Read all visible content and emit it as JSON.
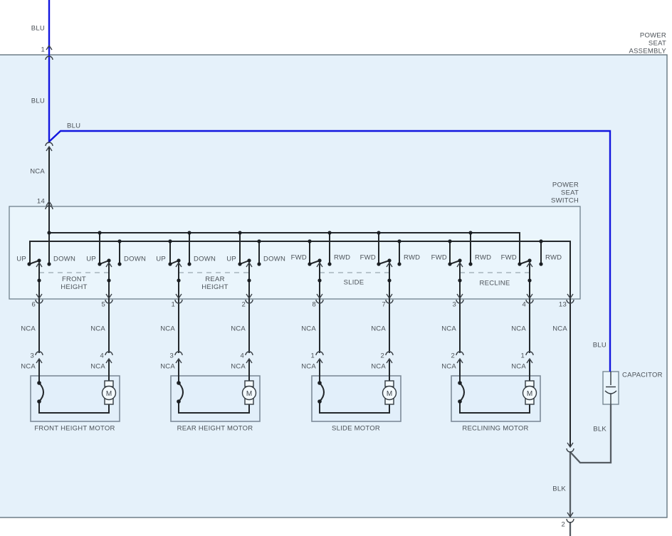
{
  "assembly_title": "POWER\nSEAT\nASSEMBLY",
  "switch_title": "POWER\nSEAT\nSWITCH",
  "labels": {
    "blu": "BLU",
    "nca": "NCA",
    "blk": "BLK",
    "up": "UP",
    "down": "DOWN",
    "fwd": "FWD",
    "rwd": "RWD",
    "capacitor": "CAPACITOR",
    "motor_m": "M"
  },
  "pins": {
    "top": "1",
    "switch_in": "14",
    "bottom": "2"
  },
  "switch_pins": [
    "6",
    "5",
    "1",
    "2",
    "8",
    "7",
    "3",
    "4",
    "13"
  ],
  "connector_pins": [
    "3",
    "4",
    "3",
    "4",
    "1",
    "2",
    "2",
    "1"
  ],
  "groups": [
    {
      "name": "FRONT\nHEIGHT"
    },
    {
      "name": "REAR\nHEIGHT"
    },
    {
      "name": "SLIDE"
    },
    {
      "name": "RECLINE"
    }
  ],
  "motors": [
    {
      "name": "FRONT HEIGHT MOTOR"
    },
    {
      "name": "REAR HEIGHT MOTOR"
    },
    {
      "name": "SLIDE MOTOR"
    },
    {
      "name": "RECLINING MOTOR"
    }
  ],
  "colors": {
    "wire_blue": "#1216df",
    "wire_black": "#24282c",
    "wire_ground_gray": "#565d63",
    "panel_fill": "#e5f1fa",
    "inner_fill": "#eaf5fc",
    "panel_stroke": "#65767f",
    "text": "#4b5157"
  }
}
